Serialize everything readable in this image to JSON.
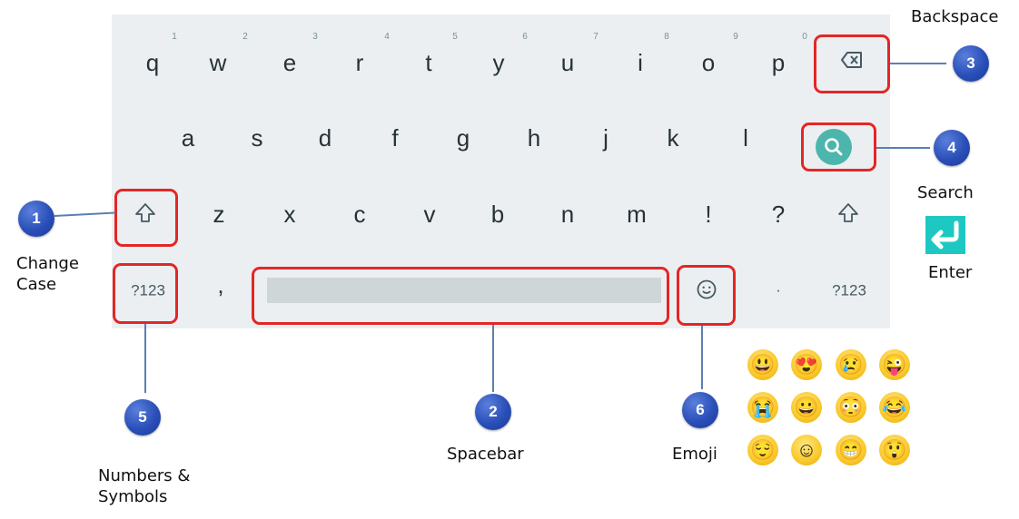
{
  "keyboard": {
    "row1": [
      {
        "letter": "q",
        "hint": "1"
      },
      {
        "letter": "w",
        "hint": "2"
      },
      {
        "letter": "e",
        "hint": "3"
      },
      {
        "letter": "r",
        "hint": "4"
      },
      {
        "letter": "t",
        "hint": "5"
      },
      {
        "letter": "y",
        "hint": "6"
      },
      {
        "letter": "u",
        "hint": "7"
      },
      {
        "letter": "i",
        "hint": "8"
      },
      {
        "letter": "o",
        "hint": "9"
      },
      {
        "letter": "p",
        "hint": "0"
      }
    ],
    "row2": [
      "a",
      "s",
      "d",
      "f",
      "g",
      "h",
      "j",
      "k",
      "l"
    ],
    "row3": [
      "z",
      "x",
      "c",
      "v",
      "b",
      "n",
      "m",
      "!",
      "?"
    ],
    "row4": {
      "left_symbols": "?123",
      "comma": ",",
      "period": ".",
      "right_symbols": "?123"
    },
    "icons": {
      "backspace": "backspace-icon",
      "search": "search-icon",
      "shift_left": "shift-icon",
      "shift_right": "shift-icon",
      "emoji": "smiley-icon"
    },
    "colors": {
      "background": "#eceff1",
      "search_accent": "#4db6ac",
      "highlight": "#e32626",
      "badge": "#2a4fb8",
      "enter_icon": "#1ec8c2"
    }
  },
  "callouts": [
    {
      "number": "1",
      "label": "Change\nCase"
    },
    {
      "number": "2",
      "label": "Spacebar"
    },
    {
      "number": "3",
      "label": "Backspace"
    },
    {
      "number": "4",
      "label": "Search"
    },
    {
      "number": "5",
      "label": "Numbers &\nSymbols"
    },
    {
      "number": "6",
      "label": "Emoji"
    }
  ],
  "enter_label": "Enter",
  "emoji_grid": [
    [
      "😃",
      "😍",
      "😢",
      "😜"
    ],
    [
      "😭",
      "😀",
      "😳",
      "😂"
    ],
    [
      "😌",
      "☺",
      "😁",
      "😲"
    ]
  ]
}
